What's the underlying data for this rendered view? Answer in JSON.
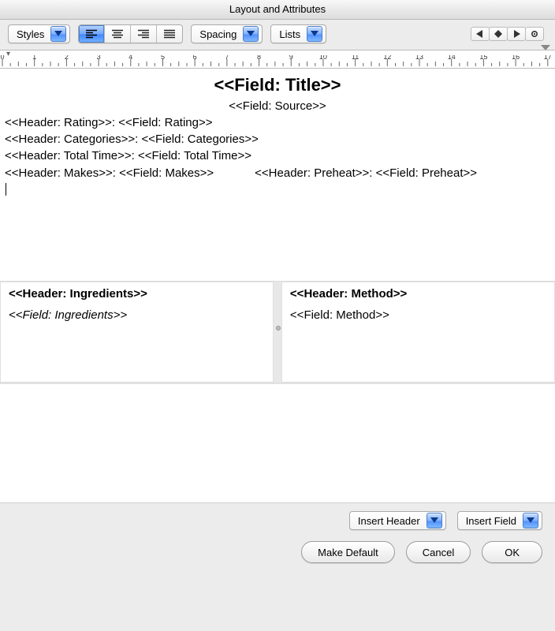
{
  "window": {
    "title": "Layout and Attributes"
  },
  "toolbar": {
    "styles_label": "Styles",
    "spacing_label": "Spacing",
    "lists_label": "Lists"
  },
  "ruler": {
    "max": 17
  },
  "doc": {
    "title": "<<Field: Title>>",
    "source": "<<Field: Source>>",
    "rating_line": "<<Header: Rating>>: <<Field: Rating>>",
    "categories_line": "<<Header: Categories>>: <<Field: Categories>>",
    "totaltime_line": "<<Header: Total Time>>: <<Field: Total Time>>",
    "makes_part": "<<Header: Makes>>: <<Field: Makes>>",
    "preheat_part": "<<Header: Preheat>>: <<Field: Preheat>>"
  },
  "panels": {
    "ingredients_header": "<<Header: Ingredients>>",
    "ingredients_field": "<<Field: Ingredients>>",
    "method_header": "<<Header: Method>>",
    "method_field": "<<Field: Method>>"
  },
  "buttons": {
    "insert_header": "Insert Header",
    "insert_field": "Insert Field",
    "make_default": "Make Default",
    "cancel": "Cancel",
    "ok": "OK"
  }
}
